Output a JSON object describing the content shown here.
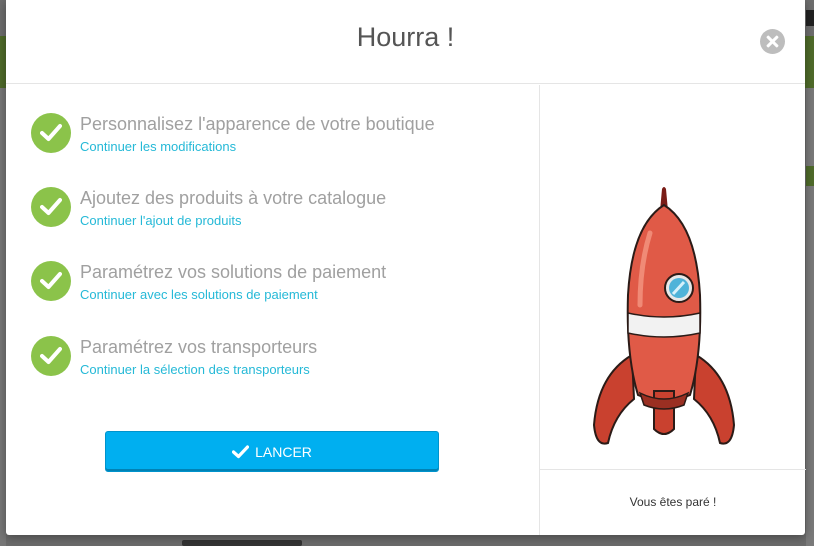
{
  "modal": {
    "title": "Hourra !",
    "close_icon": "close-icon"
  },
  "steps": [
    {
      "title": "Personnalisez l'apparence de votre boutique",
      "link": "Continuer les modifications"
    },
    {
      "title": "Ajoutez des produits à votre catalogue",
      "link": "Continuer l'ajout de produits"
    },
    {
      "title": "Paramétrez vos solutions de paiement",
      "link": "Continuer avec les solutions de paiement"
    },
    {
      "title": "Paramétrez vos transporteurs",
      "link": "Continuer la sélection des transporteurs"
    }
  ],
  "launch_button": {
    "label": "LANCER",
    "icon": "check-icon"
  },
  "illustration": {
    "icon": "rocket-icon"
  },
  "footer": {
    "ready_text": "Vous êtes paré !"
  },
  "colors": {
    "accent": "#00aff0",
    "link": "#25b9d7",
    "success": "#8bc34a",
    "rocket": "#e05a47"
  }
}
